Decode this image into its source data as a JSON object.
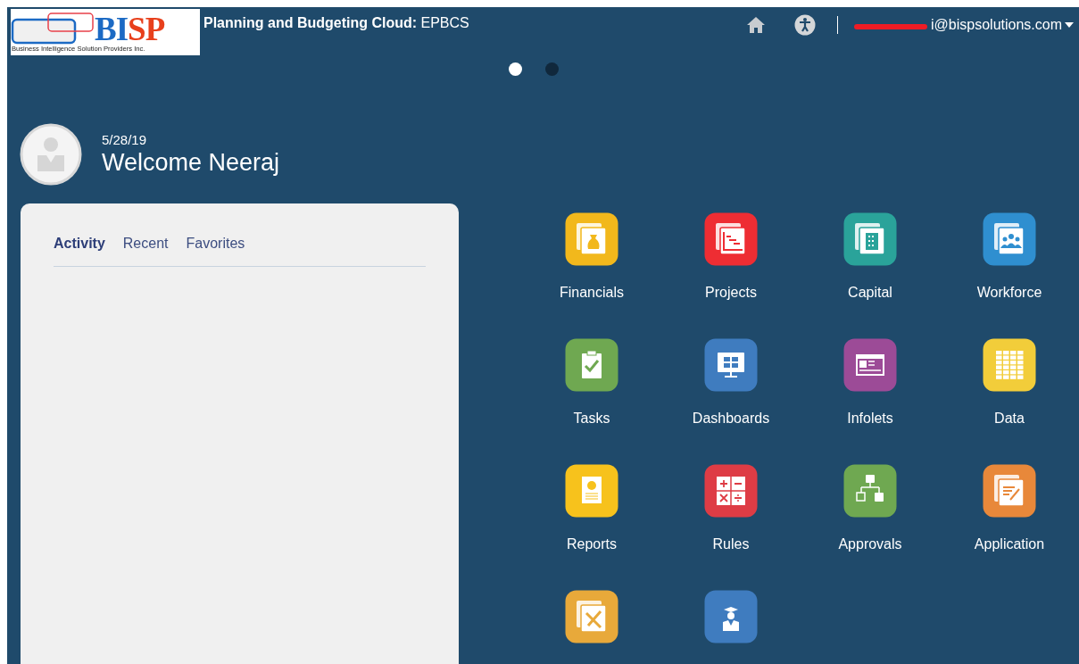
{
  "logo": {
    "mark": "BISP",
    "tagline": "Business Intelligence Solution Providers Inc."
  },
  "header": {
    "title_bold": "Planning and Budgeting Cloud:",
    "title": "EPBCS",
    "user_email": "i@bispsolutions.com",
    "email_redacted": true
  },
  "carousel_dots": [
    {
      "selected": true
    },
    {
      "selected": false
    }
  ],
  "welcome": {
    "date": "5/28/19",
    "greeting": "Welcome Neeraj"
  },
  "tabs": [
    {
      "label": "Activity",
      "selected": true
    },
    {
      "label": "Recent",
      "selected": false
    },
    {
      "label": "Favorites",
      "selected": false
    }
  ],
  "cards": [
    {
      "label": "Financials",
      "color": "#f2b81c"
    },
    {
      "label": "Projects",
      "color": "#ee2d33"
    },
    {
      "label": "Capital",
      "color": "#2aa39a"
    },
    {
      "label": "Workforce",
      "color": "#2f8fd0"
    },
    {
      "label": "Tasks",
      "color": "#6fa851"
    },
    {
      "label": "Dashboards",
      "color": "#3f7cbf"
    },
    {
      "label": "Infolets",
      "color": "#9c4b97"
    },
    {
      "label": "Data",
      "color": "#f2cd3a"
    },
    {
      "label": "Reports",
      "color": "#f7c21c"
    },
    {
      "label": "Rules",
      "color": "#de3c45"
    },
    {
      "label": "Approvals",
      "color": "#6fa851"
    },
    {
      "label": "Application",
      "color": "#e8883a"
    },
    {
      "color": "#e8a93a"
    },
    {
      "color": "#3f7cbf"
    }
  ]
}
